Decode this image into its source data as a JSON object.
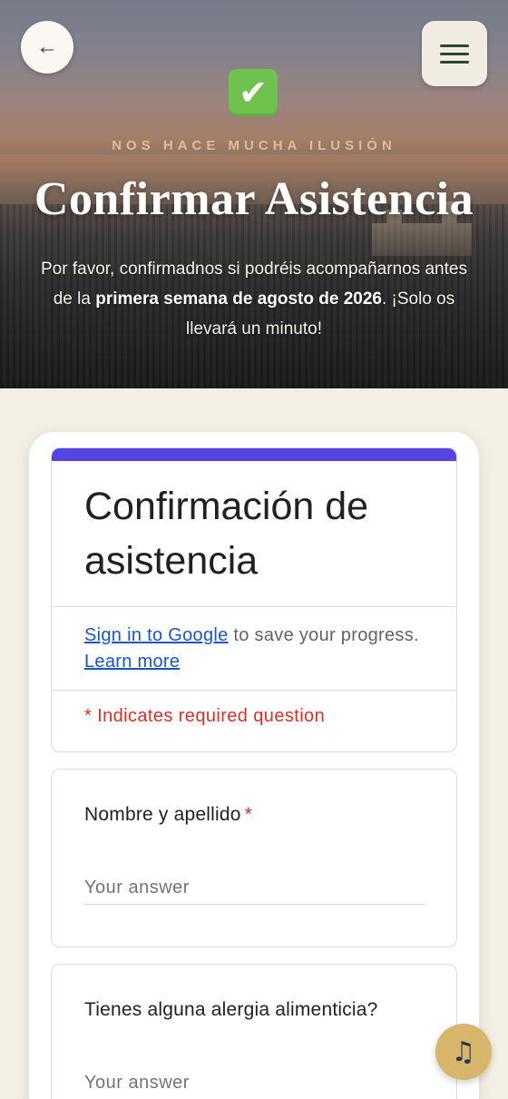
{
  "nav": {
    "back_symbol": "←"
  },
  "hero": {
    "check_symbol": "✔",
    "eyebrow": "NOS HACE MUCHA ILUSIÓN",
    "title": "Confirmar Asistencia",
    "text_before": "Por favor, confirmadnos si podréis acompañarnos antes de la ",
    "text_bold": "primera semana de agosto de 2026",
    "text_after": ". ¡Solo os llevará un minuto!"
  },
  "form": {
    "accent_color": "#5445e0",
    "title": "Confirmación de asistencia",
    "signin_link": "Sign in to Google",
    "signin_rest": " to save your progress.",
    "learn_more": "Learn more",
    "required_note": "* Indicates required question",
    "questions": [
      {
        "label": "Nombre y apellido",
        "required_mark": "*",
        "placeholder": "Your answer"
      },
      {
        "label": "Tienes alguna alergia alimenticia?",
        "placeholder": "Your answer"
      }
    ]
  },
  "music": {
    "symbol": "♫"
  }
}
